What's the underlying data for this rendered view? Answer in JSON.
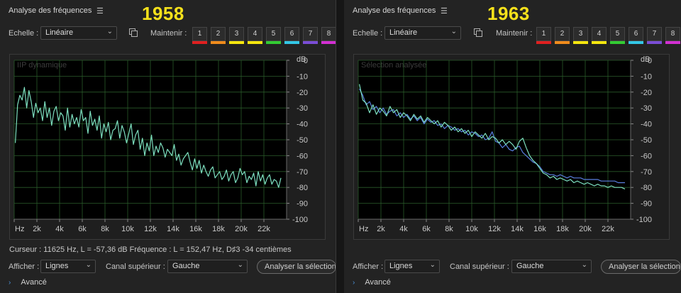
{
  "memory_labels": [
    "1",
    "2",
    "3",
    "4",
    "5",
    "6",
    "7",
    "8"
  ],
  "memory_colors": [
    "#e02020",
    "#f08b1c",
    "#f5e60f",
    "#f5e60f",
    "#33cc33",
    "#33c7e6",
    "#7a4dd6",
    "#d22fd2"
  ],
  "line_colors": {
    "green": "#7de0c0",
    "blue": "#5a7fe0"
  },
  "panels": [
    {
      "title": "Analyse des fréquences",
      "year": "1958",
      "echelle_label": "Echelle :",
      "echelle_value": "Linéaire",
      "maintenir_label": "Maintenir :",
      "watermark": "IIP dynamique",
      "status": "Curseur : 11625 Hz, L = -57,36 dB   Fréquence : L = 152,47 Hz, D♯3 -34 centièmes",
      "afficher_label": "Afficher :",
      "afficher_value": "Lignes",
      "canal_label": "Canal supérieur :",
      "canal_value": "Gauche",
      "analyze_button": "Analyser la sélection",
      "advanced": "Avancé"
    },
    {
      "title": "Analyse des fréquences",
      "year": "1963",
      "echelle_label": "Echelle :",
      "echelle_value": "Linéaire",
      "maintenir_label": "Maintenir :",
      "watermark": "Sélection analysée",
      "status": "",
      "afficher_label": "Afficher :",
      "afficher_value": "Lignes",
      "canal_label": "Canal supérieur :",
      "canal_value": "Gauche",
      "analyze_button": "Analyser la sélection",
      "advanced": "Avancé"
    }
  ],
  "chart_data": [
    {
      "type": "line",
      "xlabel": "",
      "ylabel": "dB",
      "x_unit": "Hz",
      "xlim": [
        0,
        24000
      ],
      "ylim": [
        -100,
        0
      ],
      "x_ticks": [
        "Hz",
        "2k",
        "4k",
        "6k",
        "8k",
        "10k",
        "12k",
        "14k",
        "16k",
        "18k",
        "20k",
        "22k"
      ],
      "y_ticks": [
        "0",
        "-10",
        "-20",
        "-30",
        "-40",
        "-50",
        "-60",
        "-70",
        "-80",
        "-90",
        "-100"
      ],
      "grid": true,
      "series": [
        {
          "color": "green",
          "x": [
            100,
            300,
            500,
            700,
            900,
            1100,
            1300,
            1500,
            1700,
            1900,
            2100,
            2300,
            2500,
            2700,
            2900,
            3100,
            3300,
            3500,
            3700,
            3900,
            4100,
            4300,
            4500,
            4700,
            4900,
            5100,
            5300,
            5500,
            5700,
            5900,
            6100,
            6300,
            6500,
            6700,
            6900,
            7100,
            7300,
            7500,
            7700,
            7900,
            8100,
            8300,
            8500,
            8700,
            8900,
            9100,
            9300,
            9500,
            9700,
            9900,
            10100,
            10300,
            10500,
            10700,
            10900,
            11100,
            11300,
            11500,
            11700,
            11900,
            12100,
            12300,
            12500,
            12700,
            12900,
            13100,
            13300,
            13500,
            13700,
            13900,
            14100,
            14300,
            14500,
            14700,
            14900,
            15100,
            15300,
            15500,
            15700,
            15900,
            16100,
            16300,
            16500,
            16700,
            16900,
            17100,
            17300,
            17500,
            17700,
            17900,
            18100,
            18300,
            18500,
            18700,
            18900,
            19100,
            19300,
            19500,
            19700,
            19900,
            20100,
            20300,
            20500,
            20700,
            20900,
            21100,
            21300,
            21500,
            21700,
            21900,
            22100,
            22300,
            22500,
            22700,
            22900,
            23100,
            23300,
            23500
          ],
          "y": [
            -52,
            -28,
            -22,
            -25,
            -17,
            -30,
            -19,
            -26,
            -36,
            -27,
            -33,
            -30,
            -38,
            -26,
            -36,
            -30,
            -41,
            -32,
            -29,
            -38,
            -33,
            -35,
            -44,
            -30,
            -42,
            -34,
            -40,
            -36,
            -42,
            -31,
            -38,
            -36,
            -46,
            -32,
            -41,
            -37,
            -44,
            -35,
            -49,
            -40,
            -45,
            -39,
            -50,
            -44,
            -43,
            -38,
            -49,
            -41,
            -45,
            -52,
            -46,
            -40,
            -53,
            -47,
            -44,
            -56,
            -49,
            -60,
            -52,
            -57,
            -47,
            -60,
            -54,
            -58,
            -52,
            -55,
            -61,
            -56,
            -58,
            -60,
            -53,
            -63,
            -59,
            -66,
            -62,
            -60,
            -58,
            -64,
            -69,
            -62,
            -68,
            -63,
            -71,
            -66,
            -70,
            -73,
            -69,
            -67,
            -74,
            -72,
            -70,
            -75,
            -73,
            -69,
            -76,
            -72,
            -70,
            -77,
            -74,
            -68,
            -72,
            -70,
            -77,
            -73,
            -75,
            -71,
            -79,
            -70,
            -76,
            -72,
            -78,
            -74,
            -72,
            -78,
            -75,
            -76,
            -80,
            -74
          ]
        }
      ]
    },
    {
      "type": "line",
      "xlabel": "",
      "ylabel": "dB",
      "x_unit": "Hz",
      "xlim": [
        0,
        24000
      ],
      "ylim": [
        -100,
        0
      ],
      "x_ticks": [
        "Hz",
        "2k",
        "4k",
        "6k",
        "8k",
        "10k",
        "12k",
        "14k",
        "16k",
        "18k",
        "20k",
        "22k"
      ],
      "y_ticks": [
        "0",
        "-10",
        "-20",
        "-30",
        "-40",
        "-50",
        "-60",
        "-70",
        "-80",
        "-90",
        "-100"
      ],
      "grid": true,
      "series": [
        {
          "color": "blue",
          "x": [
            100,
            400,
            700,
            1000,
            1300,
            1600,
            1900,
            2200,
            2500,
            2800,
            3100,
            3400,
            3700,
            4000,
            4300,
            4600,
            4900,
            5200,
            5500,
            5800,
            6100,
            6400,
            6700,
            7000,
            7300,
            7600,
            7900,
            8200,
            8500,
            8800,
            9100,
            9400,
            9700,
            10000,
            10300,
            10600,
            10900,
            11200,
            11500,
            11800,
            12100,
            12400,
            12700,
            13000,
            13300,
            13600,
            13900,
            14200,
            14500,
            14800,
            15100,
            15400,
            15700,
            16000,
            16300,
            16600,
            16900,
            17200,
            17500,
            17800,
            18100,
            18400,
            18700,
            19000,
            19300,
            19600,
            19900,
            20200,
            20500,
            20800,
            21100,
            21400,
            21700,
            22000,
            22300,
            22600,
            22900,
            23200,
            23500
          ],
          "y": [
            -18,
            -22,
            -28,
            -26,
            -31,
            -29,
            -33,
            -30,
            -34,
            -32,
            -31,
            -35,
            -33,
            -36,
            -34,
            -37,
            -35,
            -38,
            -36,
            -40,
            -37,
            -39,
            -38,
            -41,
            -40,
            -43,
            -41,
            -42,
            -44,
            -43,
            -45,
            -44,
            -47,
            -45,
            -46,
            -48,
            -47,
            -50,
            -49,
            -45,
            -51,
            -52,
            -55,
            -53,
            -56,
            -57,
            -55,
            -54,
            -58,
            -60,
            -62,
            -64,
            -65,
            -67,
            -70,
            -71,
            -72,
            -72,
            -73,
            -72,
            -73,
            -74,
            -73,
            -74,
            -74,
            -74,
            -75,
            -75,
            -75,
            -75,
            -75,
            -76,
            -76,
            -76,
            -76,
            -76,
            -77,
            -77,
            -77
          ]
        },
        {
          "color": "green",
          "x": [
            100,
            400,
            700,
            1000,
            1300,
            1600,
            1900,
            2200,
            2500,
            2800,
            3100,
            3400,
            3700,
            4000,
            4300,
            4600,
            4900,
            5200,
            5500,
            5800,
            6100,
            6400,
            6700,
            7000,
            7300,
            7600,
            7900,
            8200,
            8500,
            8800,
            9100,
            9400,
            9700,
            10000,
            10300,
            10600,
            10900,
            11200,
            11500,
            11800,
            12100,
            12400,
            12700,
            13000,
            13300,
            13600,
            13900,
            14200,
            14500,
            14800,
            15100,
            15400,
            15700,
            16000,
            16300,
            16600,
            16900,
            17200,
            17500,
            17800,
            18100,
            18400,
            18700,
            19000,
            19300,
            19600,
            19900,
            20200,
            20500,
            20800,
            21100,
            21400,
            21700,
            22000,
            22300,
            22600,
            22900,
            23200,
            23500
          ],
          "y": [
            -15,
            -25,
            -27,
            -33,
            -28,
            -34,
            -30,
            -32,
            -35,
            -29,
            -33,
            -31,
            -36,
            -33,
            -35,
            -38,
            -34,
            -37,
            -35,
            -39,
            -36,
            -38,
            -40,
            -38,
            -42,
            -39,
            -41,
            -44,
            -42,
            -45,
            -43,
            -46,
            -44,
            -48,
            -45,
            -47,
            -49,
            -46,
            -50,
            -48,
            -49,
            -52,
            -50,
            -53,
            -51,
            -53,
            -56,
            -51,
            -49,
            -55,
            -60,
            -63,
            -65,
            -68,
            -71,
            -72,
            -74,
            -73,
            -75,
            -74,
            -75,
            -76,
            -75,
            -77,
            -76,
            -77,
            -78,
            -77,
            -78,
            -79,
            -78,
            -79,
            -79,
            -80,
            -79,
            -80,
            -80,
            -80,
            -81
          ]
        }
      ]
    }
  ]
}
